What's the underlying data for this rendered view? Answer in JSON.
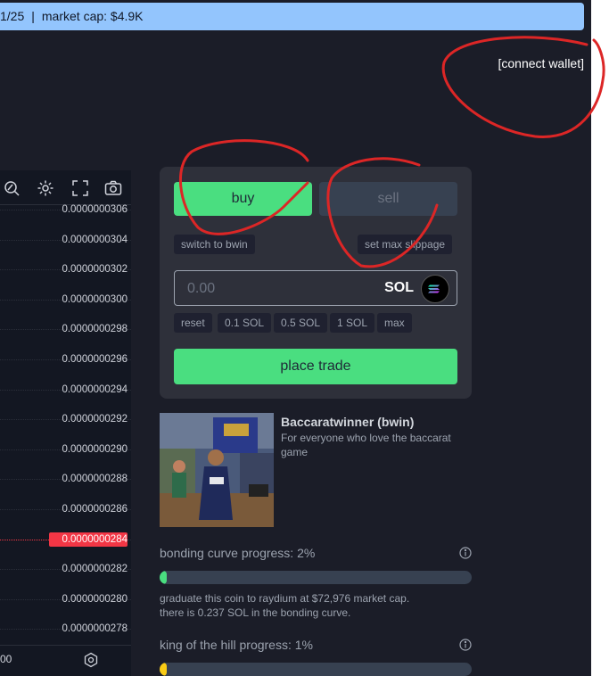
{
  "banner": {
    "left_text": "1/25",
    "separator": "|",
    "market_cap": "market cap: $4.9K"
  },
  "header": {
    "connect_wallet": "[connect wallet]"
  },
  "chart": {
    "price_labels": [
      "0.0000000306",
      "0.0000000304",
      "0.0000000302",
      "0.0000000300",
      "0.0000000298",
      "0.0000000296",
      "0.0000000294",
      "0.0000000292",
      "0.0000000290",
      "0.0000000288",
      "0.0000000286",
      "0.0000000284",
      "0.0000000282",
      "0.0000000280",
      "0.0000000278"
    ],
    "current_price": "0.0000000284",
    "footer_time": "00"
  },
  "trade": {
    "buy_label": "buy",
    "sell_label": "sell",
    "switch_label": "switch to bwin",
    "max_slippage_label": "set max slippage",
    "amount_placeholder": "0.00",
    "currency": "SOL",
    "presets": [
      "reset",
      "0.1 SOL",
      "0.5 SOL",
      "1 SOL",
      "max"
    ],
    "place_trade_label": "place trade"
  },
  "token": {
    "name": "Baccaratwinner (bwin)",
    "description": "For everyone who love the baccarat game"
  },
  "bonding": {
    "title": "bonding curve progress: 2%",
    "progress": 0.02,
    "line1": "graduate this coin to raydium at $72,976 market cap.",
    "line2": "there is 0.237 SOL in the bonding curve."
  },
  "koth": {
    "title": "king of the hill progress: 1%",
    "progress": 0.01
  },
  "colors": {
    "accent_green": "#4ade80",
    "koth_yellow": "#facc15",
    "price_red": "#f23645",
    "banner_blue": "#93c5fd"
  },
  "icons": [
    "zoom-icon",
    "gear-icon",
    "fullscreen-icon",
    "camera-icon",
    "solana-icon",
    "info-icon"
  ]
}
